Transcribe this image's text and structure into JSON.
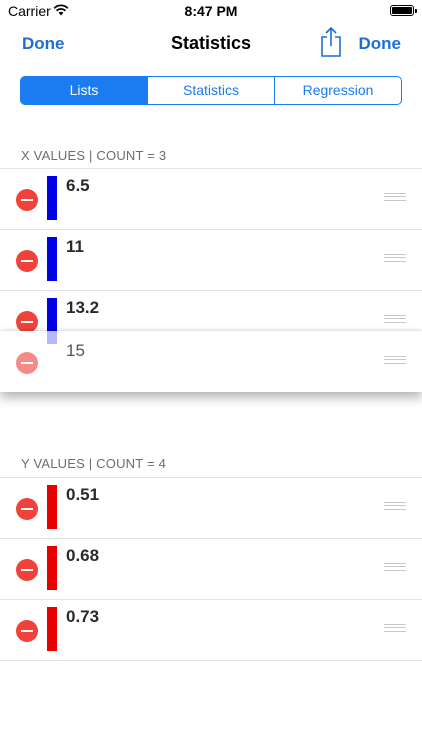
{
  "status_bar": {
    "carrier": "Carrier",
    "time": "8:47 PM"
  },
  "nav": {
    "left_label": "Done",
    "title": "Statistics",
    "right_label": "Done"
  },
  "segments": [
    {
      "label": "Lists",
      "active": true
    },
    {
      "label": "Statistics",
      "active": false
    },
    {
      "label": "Regression",
      "active": false
    }
  ],
  "x_section": {
    "header": "X VALUES | COUNT = 3",
    "color": "#0000e6",
    "items": [
      "6.5",
      "11",
      "13.2"
    ]
  },
  "dragging_item": {
    "value": "15"
  },
  "y_section": {
    "header": "Y VALUES | COUNT = 4",
    "color": "#e60000",
    "items": [
      "0.51",
      "0.68",
      "0.73"
    ]
  },
  "colors": {
    "accent": "#1a7cf0",
    "delete": "#f0413a"
  }
}
